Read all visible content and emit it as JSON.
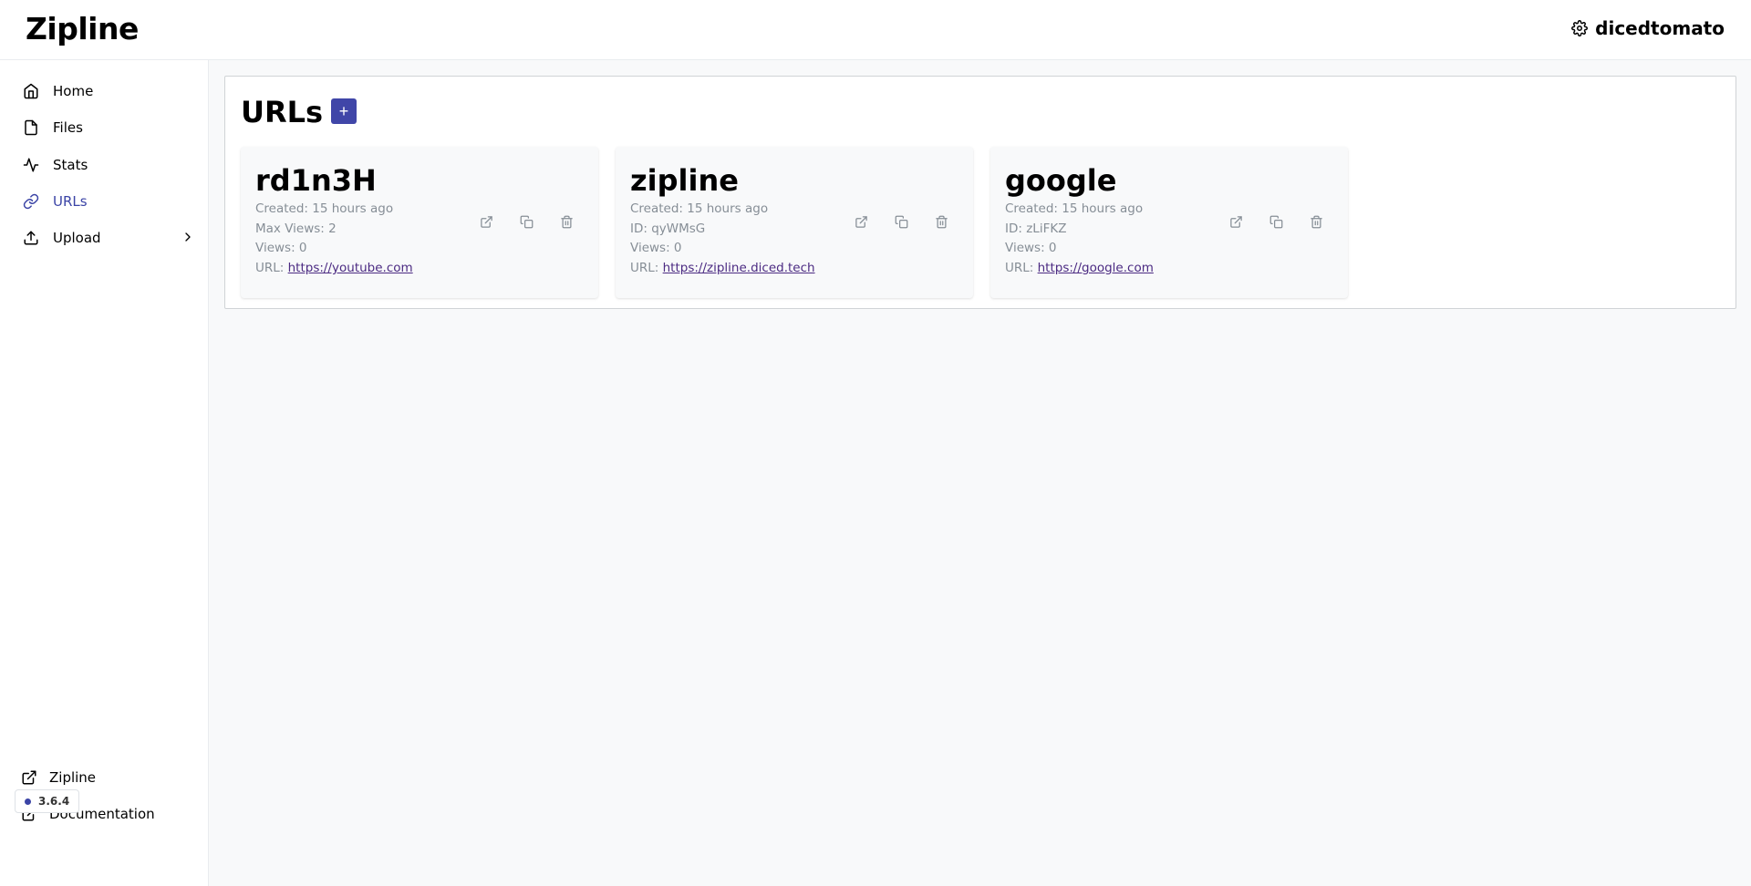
{
  "app": {
    "title": "Zipline"
  },
  "user": {
    "name": "dicedtomato"
  },
  "nav": {
    "items": [
      {
        "label": "Home"
      },
      {
        "label": "Files"
      },
      {
        "label": "Stats"
      },
      {
        "label": "URLs"
      },
      {
        "label": "Upload"
      }
    ],
    "footer": [
      {
        "label": "Zipline"
      },
      {
        "label": "Documentation"
      }
    ],
    "version": "3.6.4"
  },
  "page": {
    "title": "URLs",
    "add_label": "+"
  },
  "cards": [
    {
      "title": "rd1n3H",
      "created": "Created: 15 hours ago",
      "second": "Max Views: 2",
      "views": "Views: 0",
      "url_prefix": "URL: ",
      "url": "https://youtube.com"
    },
    {
      "title": "zipline",
      "created": "Created: 15 hours ago",
      "second": "ID: qyWMsG",
      "views": "Views: 0",
      "url_prefix": "URL: ",
      "url": "https://zipline.diced.tech"
    },
    {
      "title": "google",
      "created": "Created: 15 hours ago",
      "second": "ID: zLiFKZ",
      "views": "Views: 0",
      "url_prefix": "URL: ",
      "url": "https://google.com"
    }
  ],
  "colors": {
    "accent": "#4046a8",
    "active_nav": "#3b44a6",
    "link": "#4b2a82"
  }
}
